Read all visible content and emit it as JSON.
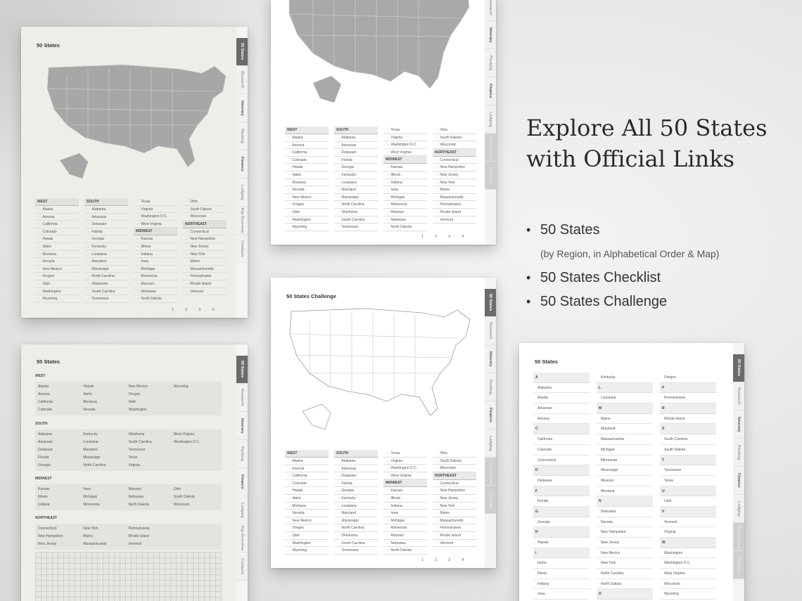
{
  "hero": {
    "title_line1": "Explore All 50 States",
    "title_line2": "with Official Links",
    "bullets": [
      "50 States",
      "50 States Checklist",
      "50 States Challenge"
    ],
    "bullet1_sub": "(by Region, in Alphabetical Order & Map)"
  },
  "tabs": [
    "50 States",
    "Research",
    "Itinerary",
    "Packing",
    "Finance",
    "Lodging",
    "Trip Overview",
    "Contacts"
  ],
  "page_numbers": [
    "1",
    "2",
    "3",
    "4"
  ],
  "page1": {
    "title": "50 States"
  },
  "page3": {
    "title": "50 States"
  },
  "page4": {
    "title": "50 States Challenge"
  },
  "page5": {
    "title": "50 States"
  },
  "regions": {
    "west_label": "WEST",
    "south_label": "SOUTH",
    "midwest_label": "MIDWEST",
    "northeast_label": "NORTHEAST",
    "west": [
      "Alaska",
      "Arizona",
      "California",
      "Colorado",
      "Hawaii",
      "Idaho",
      "Montana",
      "Nevada",
      "New Mexico",
      "Oregon",
      "Utah",
      "Washington",
      "Wyoming"
    ],
    "south": [
      "Alabama",
      "Arkansas",
      "Delaware",
      "Florida",
      "Georgia",
      "Kentucky",
      "Louisiana",
      "Maryland",
      "Mississippi",
      "North Carolina",
      "Oklahoma",
      "South Carolina",
      "Tennessee"
    ],
    "south_cont": [
      "Texas",
      "Virginia",
      "Washington D.C.",
      "West Virginia"
    ],
    "midwest": [
      "Kansas",
      "Illinois",
      "Indiana",
      "Iowa",
      "Michigan",
      "Minnesota",
      "Missouri",
      "Nebraska",
      "North Dakota"
    ],
    "midwest_cont": [
      "Ohio",
      "South Dakota",
      "Wisconsin"
    ],
    "northeast": [
      "Connecticut",
      "New Hampshire",
      "New Jersey",
      "New York",
      "Maine",
      "Massachusetts",
      "Pennsylvania",
      "Rhode Island",
      "Vermont"
    ]
  },
  "page3_panels": {
    "west": [
      "Alaska",
      "Hawaii",
      "New Mexico",
      "Wyoming",
      "Arizona",
      "Idaho",
      "Oregon",
      "",
      "California",
      "Montana",
      "Utah",
      "",
      "Colorado",
      "Nevada",
      "Washington",
      ""
    ],
    "south": [
      "Alabama",
      "Kentucky",
      "Oklahoma",
      "West Virginia",
      "Arkansas",
      "Louisiana",
      "South Carolina",
      "Washington D.C.",
      "Delaware",
      "Maryland",
      "Tennessee",
      "",
      "Florida",
      "Mississippi",
      "Texas",
      "",
      "Georgia",
      "North Carolina",
      "Virginia",
      ""
    ],
    "midwest": [
      "Kansas",
      "Iowa",
      "Missouri",
      "Ohio",
      "Illinois",
      "Michigan",
      "Nebraska",
      "South Dakota",
      "Indiana",
      "Minnesota",
      "North Dakota",
      "Wisconsin"
    ],
    "northeast": [
      "Connecticut",
      "New York",
      "Pennsylvania",
      "",
      "New Hampshire",
      "Maine",
      "Rhode Island",
      "",
      "New Jersey",
      "Massachusetts",
      "Vermont",
      ""
    ]
  },
  "alphabetical": {
    "col1": [
      [
        "A",
        true
      ],
      [
        "Alabama",
        false
      ],
      [
        "Alaska",
        false
      ],
      [
        "Arkansas",
        false
      ],
      [
        "Arizona",
        false
      ],
      [
        "C",
        true
      ],
      [
        "California",
        false
      ],
      [
        "Colorado",
        false
      ],
      [
        "Connecticut",
        false
      ],
      [
        "D",
        true
      ],
      [
        "Delaware",
        false
      ],
      [
        "F",
        true
      ],
      [
        "Florida",
        false
      ],
      [
        "G",
        true
      ],
      [
        "Georgia",
        false
      ],
      [
        "H",
        true
      ],
      [
        "Hawaii",
        false
      ],
      [
        "I",
        true
      ],
      [
        "Idaho",
        false
      ],
      [
        "Illinois",
        false
      ],
      [
        "Indiana",
        false
      ],
      [
        "Iowa",
        false
      ]
    ],
    "col2": [
      [
        "Kentucky",
        false
      ],
      [
        "L",
        true
      ],
      [
        "Louisiana",
        false
      ],
      [
        "M",
        true
      ],
      [
        "Maine",
        false
      ],
      [
        "Maryland",
        false
      ],
      [
        "Massachusetts",
        false
      ],
      [
        "Michigan",
        false
      ],
      [
        "Minnesota",
        false
      ],
      [
        "Mississippi",
        false
      ],
      [
        "Missouri",
        false
      ],
      [
        "Montana",
        false
      ],
      [
        "N",
        true
      ],
      [
        "Nebraska",
        false
      ],
      [
        "Nevada",
        false
      ],
      [
        "New Hampshire",
        false
      ],
      [
        "New Jersey",
        false
      ],
      [
        "New Mexico",
        false
      ],
      [
        "New York",
        false
      ],
      [
        "North Carolina",
        false
      ],
      [
        "North Dakota",
        false
      ],
      [
        "O",
        true
      ]
    ],
    "col3": [
      [
        "Oregon",
        false
      ],
      [
        "P",
        true
      ],
      [
        "Pennsylvania",
        false
      ],
      [
        "R",
        true
      ],
      [
        "Rhode Island",
        false
      ],
      [
        "S",
        true
      ],
      [
        "South Carolina",
        false
      ],
      [
        "South Dakota",
        false
      ],
      [
        "T",
        true
      ],
      [
        "Tennessee",
        false
      ],
      [
        "Texas",
        false
      ],
      [
        "U",
        true
      ],
      [
        "Utah",
        false
      ],
      [
        "V",
        true
      ],
      [
        "Vermont",
        false
      ],
      [
        "Virginia",
        false
      ],
      [
        "W",
        true
      ],
      [
        "Washington",
        false
      ],
      [
        "Washington D.C.",
        false
      ],
      [
        "West Virginia",
        false
      ],
      [
        "Wisconsin",
        false
      ],
      [
        "Wyoming",
        false
      ]
    ]
  }
}
